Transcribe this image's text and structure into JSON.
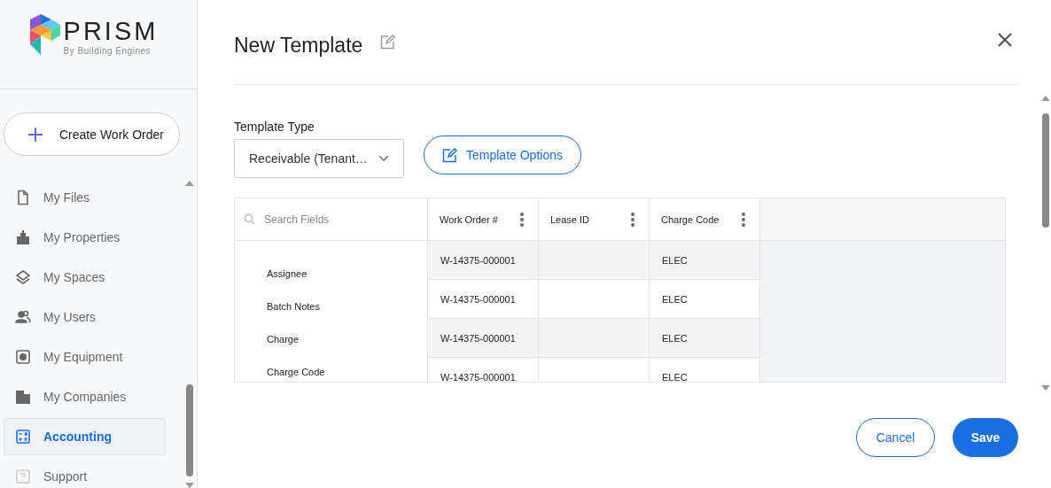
{
  "logo": {
    "name": "PRISM",
    "tagline": "By Building Engines"
  },
  "create_button": {
    "label": "Create Work Order"
  },
  "sidebar": {
    "items": [
      {
        "label": "My Files",
        "kind": "file",
        "selected": false
      },
      {
        "label": "My Properties",
        "kind": "city",
        "selected": false
      },
      {
        "label": "My Spaces",
        "kind": "layers",
        "selected": false
      },
      {
        "label": "My Users",
        "kind": "users",
        "selected": false
      },
      {
        "label": "My Equipment",
        "kind": "equipment",
        "selected": false
      },
      {
        "label": "My Companies",
        "kind": "building",
        "selected": false
      },
      {
        "label": "Accounting",
        "kind": "calculator",
        "selected": true
      },
      {
        "label": "Support",
        "kind": "help",
        "selected": false,
        "disabled": true
      }
    ]
  },
  "dialog": {
    "title": "New Template",
    "template_type": {
      "label": "Template Type",
      "value": "Receivable (Tenant…"
    },
    "options_button": "Template Options",
    "search": {
      "placeholder": "Search Fields"
    },
    "fields": [
      "Assignee",
      "Batch Notes",
      "Charge",
      "Charge Code"
    ],
    "table": {
      "columns": [
        "Work Order #",
        "Lease ID",
        "Charge Code"
      ],
      "rows": [
        [
          "W-14375-000001",
          "",
          "ELEC"
        ],
        [
          "W-14375-000001",
          "",
          "ELEC"
        ],
        [
          "W-14375-000001",
          "",
          "ELEC"
        ],
        [
          "W-14375-000001",
          "",
          "ELEC"
        ]
      ]
    },
    "buttons": {
      "cancel": "Cancel",
      "save": "Save"
    }
  }
}
